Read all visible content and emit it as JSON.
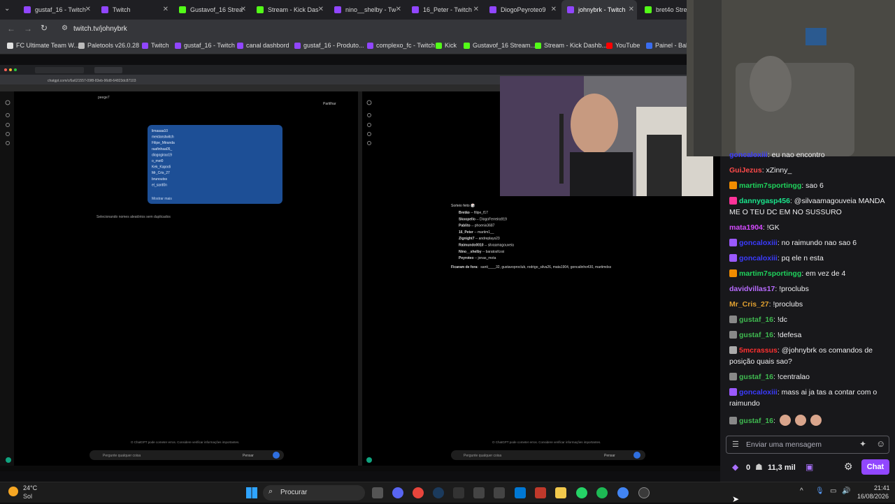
{
  "browser": {
    "tabs": [
      {
        "label": "gustaf_16 - Twitch",
        "color": "#9146ff"
      },
      {
        "label": "Twitch",
        "color": "#9146ff"
      },
      {
        "label": "Gustavof_16 Strea",
        "color": "#53fc18"
      },
      {
        "label": "Stream - Kick Das",
        "color": "#53fc18"
      },
      {
        "label": "nino__shelby - Tw",
        "color": "#9146ff"
      },
      {
        "label": "16_Peter - Twitch",
        "color": "#9146ff"
      },
      {
        "label": "DiogoPeyroteo9",
        "color": "#9146ff"
      },
      {
        "label": "johnybrk - Twitch",
        "color": "#9146ff"
      },
      {
        "label": "bret4o Stream",
        "color": "#53fc18"
      }
    ],
    "url": "twitch.tv/johnybrk",
    "bookmarks": [
      {
        "label": "FC Ultimate Team W...",
        "color": "#e0e0e0"
      },
      {
        "label": "Paletools v26.0.28",
        "color": "#bbbbbb"
      },
      {
        "label": "Twitch",
        "color": "#9146ff"
      },
      {
        "label": "gustaf_16 - Twitch",
        "color": "#9146ff"
      },
      {
        "label": "canal dashbord",
        "color": "#9146ff"
      },
      {
        "label": "gustaf_16 - Produto...",
        "color": "#9146ff"
      },
      {
        "label": "complexo_fc - Twitch",
        "color": "#9146ff"
      },
      {
        "label": "Kick",
        "color": "#53fc18"
      },
      {
        "label": "Gustavof_16 Stream...",
        "color": "#53fc18"
      },
      {
        "label": "Stream - Kick Dashb...",
        "color": "#53fc18"
      },
      {
        "label": "YouTube",
        "color": "#ff0000"
      },
      {
        "label": "Painel - Bah!",
        "color": "#3a6df0"
      }
    ]
  },
  "stream": {
    "inner_url": "chatgpt.com/c/6a621557-09f8-83eb-96d8-64823dc87103",
    "share_label": "Partilhar",
    "list_items": [
      "limaaaa10",
      "meidanstwitch",
      "Filipe_Miranda",
      "raafinhaa05_",
      "diogogirao19",
      "o_mei0",
      "Kek_Kapodi",
      "Mr_Cris_27",
      "brunoutss",
      "el_sard0n"
    ],
    "top_cut_item": "peege7",
    "show_more": "Mostrar mais",
    "selecting_text": "Selecionando nomes aleatórios sem duplicados",
    "draw_title": "Sorteio feito 🎲",
    "draw_pairs": [
      {
        "left": "Bretão",
        "right": "filipe_f17"
      },
      {
        "left": "Skoopello",
        "right": "DiogoFerreira919"
      },
      {
        "left": "Pablito",
        "right": "phoenix3687"
      },
      {
        "left": "16_Peter",
        "right": "martim1__"
      },
      {
        "left": "Zignight7",
        "right": "andreplays23"
      },
      {
        "left": "Raimundo0010",
        "right": "silvaamagouveia"
      },
      {
        "left": "Nino__shelby",
        "right": "baratosfcxxi"
      },
      {
        "left": "Peyroteo",
        "right": "jonas_mota"
      }
    ],
    "left_out_label": "Ficaram de fora:",
    "left_out_names": "santi____32, gustavoproclub, rodrigo_silva26, mata1904, goncalinho430, martimdss",
    "disclaimer": "O ChatGPT pode cometer erros. Considere verificar informações importantes.",
    "prompt_placeholder": "Pergunte qualquer coisa",
    "think_label": "Pensar"
  },
  "chat": {
    "messages": [
      {
        "user": "GuiJezus",
        "color": "#ff4a4a",
        "text": ": xZinny_"
      },
      {
        "user": "martim7sportingg",
        "color": "#1fd35c",
        "text": ": sao 6",
        "badge": "#f08c00"
      },
      {
        "user": "dannygasp456",
        "color": "#19e68c",
        "text": ": @silvaamagouveia MANDA ME O TEU DC EM NO SUSSURO",
        "badge": "#ff3399"
      },
      {
        "user": "mata1904",
        "color": "#d44bff",
        "text": ": !GK"
      },
      {
        "user": "goncaloxiii",
        "color": "#3b3bff",
        "text": ": no raimundo nao sao 6",
        "badge": "#9b59ff"
      },
      {
        "user": "goncaloxiii",
        "color": "#3b3bff",
        "text": ": pq ele n esta",
        "badge": "#9b59ff"
      },
      {
        "user": "martim7sportingg",
        "color": "#1fd35c",
        "text": ": em vez de 4",
        "badge": "#f08c00"
      },
      {
        "user": "davidvillas17",
        "color": "#b86bff",
        "text": ": !proclubs"
      },
      {
        "user": "Mr_Cris_27",
        "color": "#e0a030",
        "text": ": !proclubs"
      },
      {
        "user": "gustaf_16",
        "color": "#3fb950",
        "text": ": !dc",
        "badge": "#888888"
      },
      {
        "user": "gustaf_16",
        "color": "#3fb950",
        "text": ": !defesa",
        "badge": "#888888"
      },
      {
        "user": "5mcrassus",
        "color": "#ff3030",
        "text": ": @johnybrk os comandos de posição quais sao?",
        "badge": "#aaaaaa"
      },
      {
        "user": "gustaf_16",
        "color": "#3fb950",
        "text": ": !centralao",
        "badge": "#888888"
      },
      {
        "user": "goncaloxiii",
        "color": "#3b3bff",
        "text": ": mass ai ja tas a contar com o raimundo",
        "badge": "#9b59ff"
      },
      {
        "user": "gustaf_16",
        "color": "#3fb950",
        "text": ":",
        "badge": "#888888"
      }
    ],
    "top_cut_text": ": eu nao encontro",
    "input_placeholder": "Enviar uma mensagem",
    "points": "0",
    "viewers": "11,3 mil",
    "chat_button": "Chat"
  },
  "taskbar": {
    "temperature": "24°C",
    "weather": "Sol",
    "search_placeholder": "Procurar",
    "time": "21:41",
    "date": "16/08/2026"
  }
}
